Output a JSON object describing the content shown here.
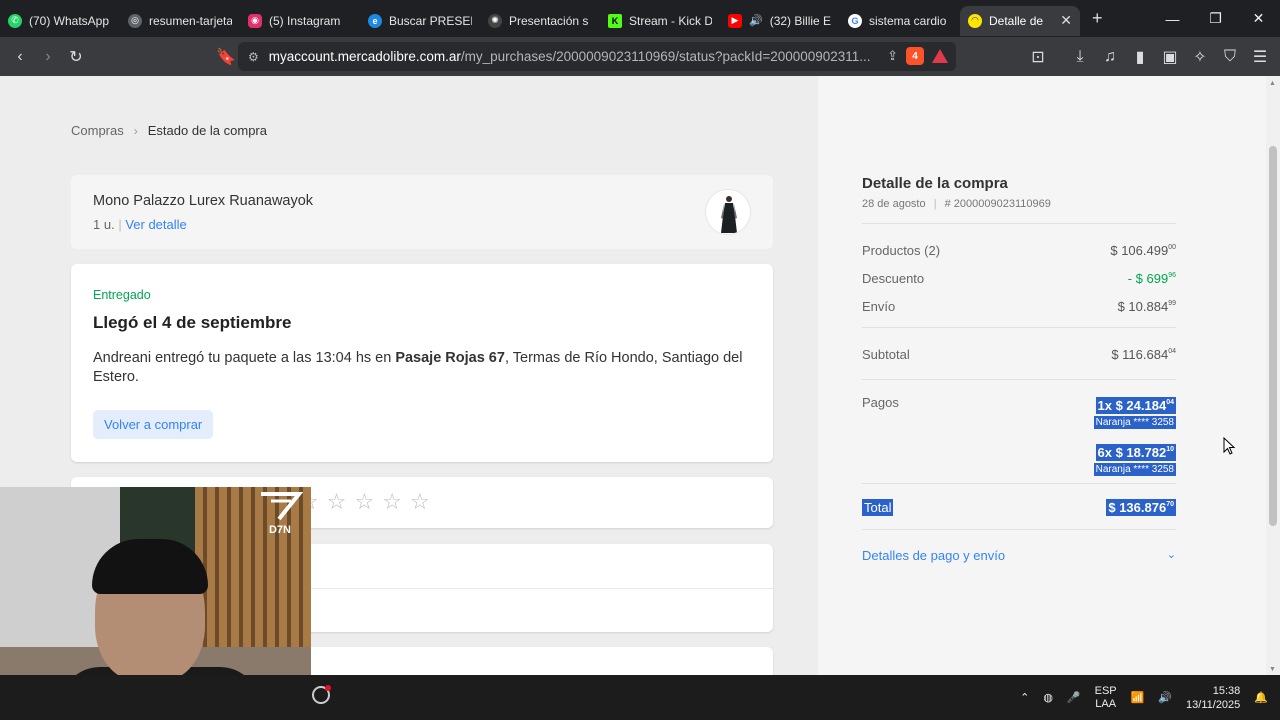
{
  "browser": {
    "tabs": [
      {
        "title": "(70) WhatsApp",
        "favicon_color": "#25d366"
      },
      {
        "title": "resumen-tarjeta",
        "favicon_color": "#9aa0a6"
      },
      {
        "title": "(5) Instagram",
        "favicon_color": "#e1306c"
      },
      {
        "title": "Buscar PRESEN",
        "favicon_color": "#1e88e5"
      },
      {
        "title": "Presentación s",
        "favicon_color": "#9aa0a6"
      },
      {
        "title": "Stream - Kick D",
        "favicon_color": "#53fc18"
      },
      {
        "title": "(32) Billie E",
        "favicon_color": "#ff0000"
      },
      {
        "title": "sistema cardio",
        "favicon_color": "#4285f4"
      },
      {
        "title": "Detalle de",
        "favicon_color": "#ffe600"
      }
    ],
    "url_host": "myaccount.mercadolibre.com.ar",
    "url_path": "/my_purchases/2000009023110969/status?packId=200000902311...",
    "brave_badge": "4"
  },
  "breadcrumb": {
    "parent": "Compras",
    "current": "Estado de la compra"
  },
  "product": {
    "name": "Mono Palazzo Lurex Ruanawayok",
    "quantity": "1 u.",
    "separator": "|",
    "detail_link": "Ver detalle"
  },
  "status": {
    "label": "Entregado",
    "title": "Llegó el 4 de septiembre",
    "desc_before": "Andreani entregó tu paquete a las 13:04 hs en ",
    "desc_bold": "Pasaje Rojas 67",
    "desc_after": ", Termas de Río Hondo, Santiago del Estero.",
    "rebuy_button": "Volver a comprar"
  },
  "rating": {
    "stars": 5
  },
  "summary": {
    "title": "Detalle de la compra",
    "date": "28 de agosto",
    "order_label": "# 2000009023110969",
    "products_label": "Productos (2)",
    "products_amount": "$ 106.499",
    "products_cents": "00",
    "discount_label": "Descuento",
    "discount_amount": "- $ 699",
    "discount_cents": "96",
    "shipping_label": "Envío",
    "shipping_amount": "$ 10.884",
    "shipping_cents": "99",
    "subtotal_label": "Subtotal",
    "subtotal_amount": "$ 116.684",
    "subtotal_cents": "04",
    "payments_label": "Pagos",
    "payment1_amount": "1x $ 24.184",
    "payment1_cents": "04",
    "payment1_card": "Naranja **** 3258",
    "payment2_amount": "6x $ 18.782",
    "payment2_cents": "10",
    "payment2_card": "Naranja **** 3258",
    "total_label": "Total",
    "total_amount": "$ 136.876",
    "total_cents": "70",
    "details_link": "Detalles de pago y envío"
  },
  "webcam": {
    "logo_text": "D7N"
  },
  "taskbar": {
    "lang1": "ESP",
    "lang2": "LAA",
    "time": "15:38",
    "date": "13/11/2025"
  },
  "colors": {
    "accent": "#3483fa",
    "success": "#00a650",
    "selection": "#2a62c9"
  }
}
